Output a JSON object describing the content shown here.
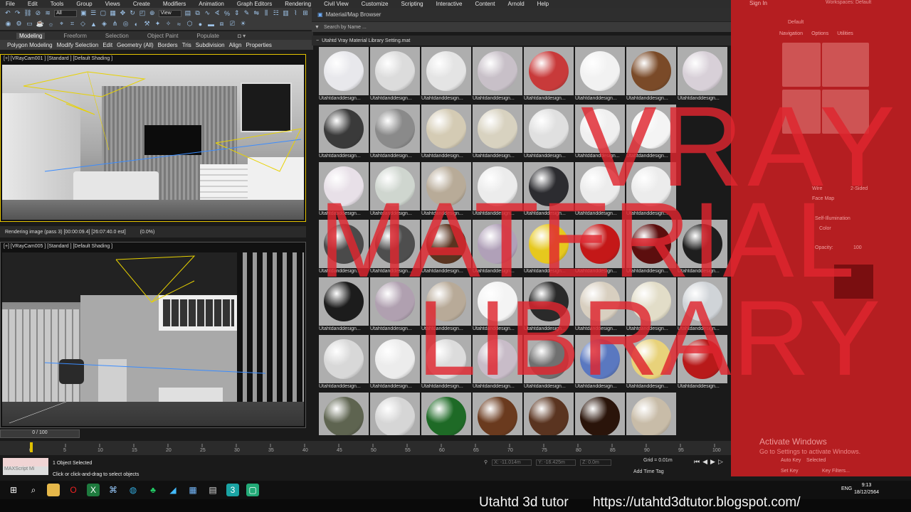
{
  "menu": [
    "File",
    "Edit",
    "Tools",
    "Group",
    "Views",
    "Create",
    "Modifiers",
    "Animation",
    "Graph Editors",
    "Rendering",
    "Civil View",
    "Customize",
    "Scripting",
    "Interactive",
    "Content",
    "Arnold",
    "Help"
  ],
  "toolbar": {
    "select_filter": "All",
    "view_dropdown": "View"
  },
  "ribbon": {
    "tabs": [
      "Modeling",
      "Freeform",
      "Selection",
      "Object Paint",
      "Populate"
    ],
    "items": [
      "Polygon Modeling",
      "Modify Selection",
      "Edit",
      "Geometry (All)",
      "Borders",
      "Tris",
      "Subdivision",
      "Align",
      "Properties"
    ]
  },
  "viewports": {
    "top_label": "[+] [VRayCam001 ] [Standard ] [Default Shading ]",
    "bottom_label": "[+] [VRayCam005 ] [Standard ] [Default Shading ]",
    "render_status": "Rendering image (pass 3) [00:00:09.4] [26:07:40.0 est]",
    "render_pct": "(0.0%)"
  },
  "material_browser": {
    "title": "Material/Map Browser",
    "search_placeholder": "Search by Name ...",
    "library_name": "Utahtd Vray Material Library Setting.mat",
    "swatches": [
      [
        "#e8e8ec",
        "Utahtdanddesign..."
      ],
      [
        "#dcdcdc",
        "Utahtdanddesign..."
      ],
      [
        "#e4e4e4",
        "Utahtdanddesign..."
      ],
      [
        "#c8c0c8",
        "Utahtdanddesign..."
      ],
      [
        "#c83a3a",
        "Utahtdanddesign..."
      ],
      [
        "#f2f2f2",
        "Utahtdanddesign..."
      ],
      [
        "#7a4a28",
        "Utahtdanddesign..."
      ],
      [
        "#d8d0d8",
        "Utahtdanddesign..."
      ],
      [
        "#3a3a3a",
        "Utahtdanddesign..."
      ],
      [
        "#8a8a8a",
        "Utahtdanddesign..."
      ],
      [
        "#d4cbb4",
        "Utahtdanddesign..."
      ],
      [
        "#d8d2c0",
        "Utahtdanddesign..."
      ],
      [
        "#e0e0e0",
        "Utahtdanddesign..."
      ],
      [
        "#f0f0f0",
        "Utahtddanddesign..."
      ],
      [
        "#f4f4f4",
        "Utahtdanddesign..."
      ],
      [
        "",
        ""
      ],
      [
        "#e8e0e8",
        "Utahtdanddesign..."
      ],
      [
        "#cfd6cf",
        "Utahtdanddesign..."
      ],
      [
        "#b8ab98",
        "Utahtdanddesign..."
      ],
      [
        "#ececec",
        "Utahtdanddesign..."
      ],
      [
        "#2c2c30",
        "Utahtdanddesign..."
      ],
      [
        "#ececec",
        "Utahtdanddesign..."
      ],
      [
        "#ececec",
        "Utahtdanddesign..."
      ],
      [
        "",
        ""
      ],
      [
        "#4a4a4a",
        "Utahtdanddesign..."
      ],
      [
        "#4e4e4e",
        "Utahtdanddesign..."
      ],
      [
        "#5a3420",
        "Utahtdanddesign..."
      ],
      [
        "#b0a0b8",
        "Utahtdanddesign..."
      ],
      [
        "#e6c81e",
        "Utahtdanddesign..."
      ],
      [
        "#c41818",
        "Utahtdanddesign..."
      ],
      [
        "#5c0e0e",
        "Utahtdanddesign..."
      ],
      [
        "#1e1e1e",
        "Utahtdanddesign..."
      ],
      [
        "#1c1c1c",
        "Utahtdanddesign..."
      ],
      [
        "#b0a0b0",
        "Utahtdanddesign..."
      ],
      [
        "#b8aa98",
        "Utahtdanddesign..."
      ],
      [
        "#f4f4f4",
        "Utahtdanddesign..."
      ],
      [
        "#2a2a2a",
        "Utahtdanddesign..."
      ],
      [
        "#d8cfc0",
        "Utahtdanddesign..."
      ],
      [
        "#e2ddc8",
        "Utahtdanddesign..."
      ],
      [
        "#d0d4d8",
        "Utahtdanddesign..."
      ],
      [
        "#d8d8d8",
        "Utahtdanddesign..."
      ],
      [
        "#ececec",
        "Utahtdanddesign..."
      ],
      [
        "#dcdcdc",
        "Utahtdanddesign..."
      ],
      [
        "#c8bcc8",
        "Utahtdanddesign..."
      ],
      [
        "#707070",
        "Utahtdanddesign..."
      ],
      [
        "#5a78c0",
        "Utahtdanddesign..."
      ],
      [
        "#e8d27a",
        "Utahtdanddesign..."
      ],
      [
        "#b81a1a",
        "Utahtdanddesign..."
      ],
      [
        "#5e6450",
        "",
        ""
      ],
      [
        "#d6d6d6",
        ""
      ],
      [
        "#1e6a26",
        ""
      ],
      [
        "#6a3a1e",
        ""
      ],
      [
        "#5a3420",
        ""
      ],
      [
        "#2a140a",
        ""
      ],
      [
        "#c8bca8",
        ""
      ]
    ]
  },
  "right_panel": {
    "signin": "Sign In",
    "workspaces_label": "Workspaces:",
    "workspace": "Default",
    "tab_default": "Default",
    "tabs": [
      "Navigation",
      "Options",
      "Utilities"
    ],
    "wire": "Wire",
    "two_sided": "2-Sided",
    "face_map": "Face Map",
    "self_illum": "Self-Illumination",
    "color": "Color",
    "opacity": "Opacity:",
    "opacity_val": "100",
    "auto_key": "Auto Key",
    "selected": "Selected",
    "set_key": "Set Key",
    "key_filters": "Key Filters...",
    "activate": "Activate Windows",
    "activate_sub": "Go to Settings to activate Windows."
  },
  "overlay": {
    "line1": "VRAY",
    "line2": "MATERIAL",
    "line3": "LIBRARY"
  },
  "timeline": {
    "slider": "0 / 100",
    "ticks": [
      "0",
      "5",
      "10",
      "15",
      "20",
      "25",
      "30",
      "35",
      "40",
      "45",
      "50",
      "55",
      "60",
      "65",
      "70",
      "75",
      "80",
      "85",
      "90",
      "95",
      "100"
    ]
  },
  "status": {
    "script_label": "MAXScript Mi",
    "selected": "1 Object Selected",
    "hint": "Click or click-and-drag to select objects",
    "x": "X: -11.014m",
    "y": "Y: -16.425m",
    "z": "Z: 0.0m",
    "grid": "Grid = 0.01m",
    "add_time_tag": "Add Time Tag",
    "frame": "0"
  },
  "taskbar": {
    "lang": "ENG",
    "time": "9:13",
    "date": "18/12/2564"
  },
  "caption": {
    "name": "Utahtd 3d tutor",
    "url": "https://utahtd3dtutor.blogspot.com/"
  }
}
